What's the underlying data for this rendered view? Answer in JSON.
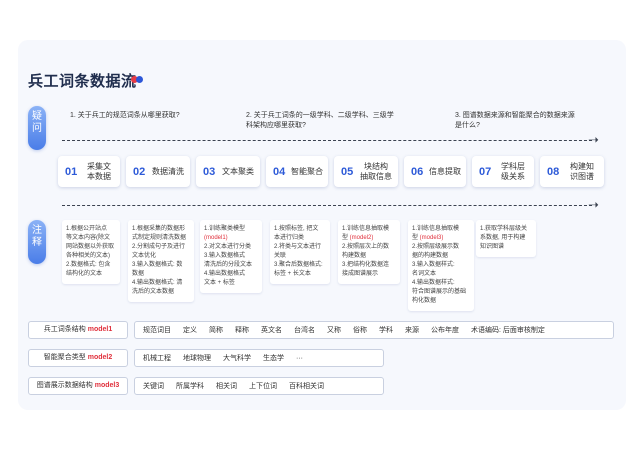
{
  "title": "兵工词条数据流",
  "pills": {
    "question": "疑\n问",
    "note": "注\n释"
  },
  "questions": [
    "1. 关于兵工的规范词条从哪里获取?",
    "2. 关于兵工词条的一级学科、二级学科、三级学科架构应哪里获取?",
    "3. 图谱数据来源和智能聚合的数据来源是什么?"
  ],
  "steps": [
    {
      "num": "01",
      "label": "采集文\n本数据"
    },
    {
      "num": "02",
      "label": "数据清洗"
    },
    {
      "num": "03",
      "label": "文本聚类"
    },
    {
      "num": "04",
      "label": "智能聚合"
    },
    {
      "num": "05",
      "label": "块结构\n抽取信息"
    },
    {
      "num": "06",
      "label": "信息提取"
    },
    {
      "num": "07",
      "label": "学科层\n级关系"
    },
    {
      "num": "08",
      "label": "构建知\n识图谱"
    }
  ],
  "notes": [
    [
      "1.根据公开站点\n等文本内容(除文\n网站数据以外获取\n各种相关的文本)\n2.数据格式: 包含\n结构化的文本"
    ],
    [
      "1.根据采集的数据形\n式制定规则清洗数据\n2.分割成句子及进行\n文本优化\n3.输入数据格式: 数\n数据\n4.输出数据格式: 清\n洗后的文本数据"
    ],
    [
      "1.训练聚类模型\n",
      "(model1)",
      "\n2.对文本进行分类\n3.输入数据格式\n清洗后的分段文本\n4.输出数据格式\n文本 + 标签"
    ],
    [
      "1.按照标签, 把文\n本进行归类\n2.将类与文本进行\n关联\n3.聚合后数据格式:\n标签 + 长文本"
    ],
    [
      "1.训练信息抽取模\n型 ",
      "(model2)",
      "\n2.按照层次上的数\n构建数据\n3.把结构化数据连\n接成图谱展示"
    ],
    [
      "1.训练信息抽取模\n型 ",
      "(model3)",
      "\n2.按照层级展示数\n据的构建数据\n3.输入数据样式:\n名词文本\n4.输出数据样式:\n符合图谱展示的基础\n构化数据"
    ],
    [
      "1.获取学科层级关\n系数据, 用于构建\n知识图谱"
    ]
  ],
  "table": [
    {
      "label_prefix": "兵工词条结构 ",
      "label_model": "model1",
      "cells": [
        "规范词目",
        "定义",
        "简称",
        "释称",
        "英文名",
        "台湾名",
        "又称",
        "俗称",
        "学科",
        "来源",
        "公布年度",
        "术语编码: 后面审核制定"
      ]
    },
    {
      "label_prefix": "智能聚合类型 ",
      "label_model": "model2",
      "cells": [
        "机械工程",
        "地球物理",
        "大气科学",
        "生态学",
        "···"
      ]
    },
    {
      "label_prefix": "图谱展示数据结构 ",
      "label_model": "model3",
      "cells": [
        "关键词",
        "所属学科",
        "相关词",
        "上下位词",
        "百科相关词"
      ]
    }
  ],
  "colors": {
    "accent": "#2d5ad8",
    "highlight": "#e0303c",
    "title": "#1f2d4d"
  }
}
